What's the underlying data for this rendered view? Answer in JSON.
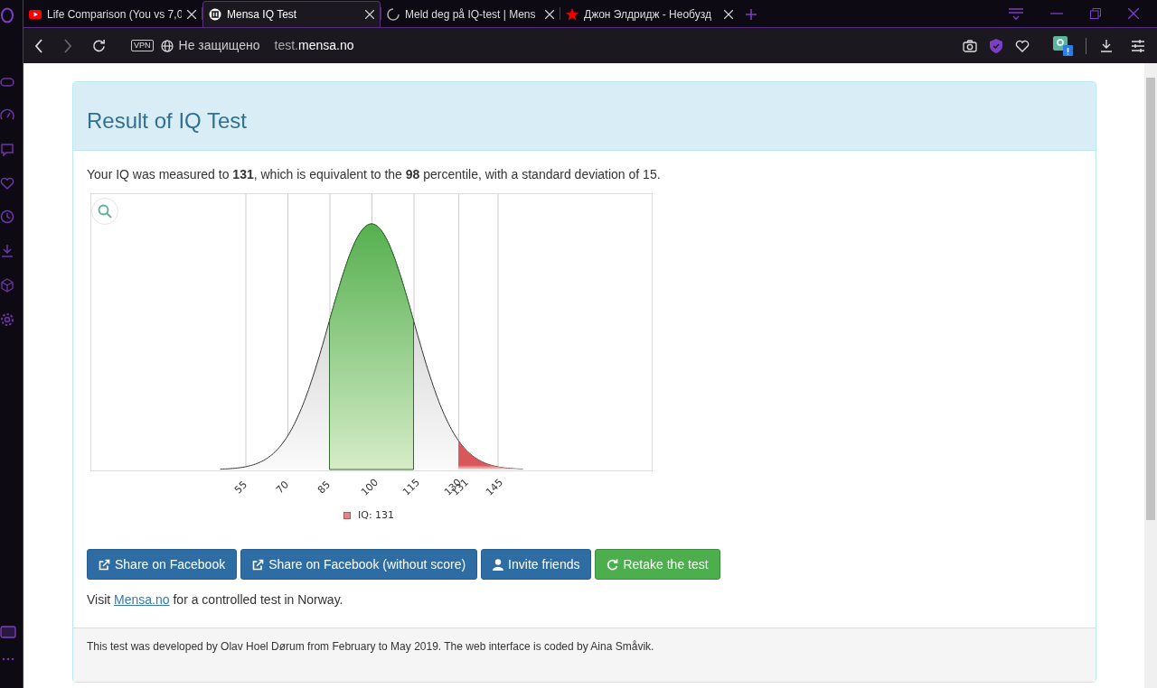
{
  "browser": {
    "tabs": [
      {
        "title": "Life Comparison (You vs 7,0",
        "kind": "video",
        "selected": false
      },
      {
        "title": "Mensa IQ Test",
        "kind": "mensa",
        "selected": true
      },
      {
        "title": "Meld deg på IQ-test | Mens",
        "kind": "loading",
        "selected": false
      },
      {
        "title": "Джон Элдридж - Необузд",
        "kind": "star",
        "selected": false
      }
    ],
    "address_bar": {
      "vpn_badge": "VPN",
      "security": "Не защищено",
      "url_subdomain": "test.",
      "url_domain": "mensa.no"
    }
  },
  "page": {
    "title": "Result of IQ Test",
    "summary": "Your IQ was measured to **131**, which is equivalent to the **98** percentile, with a standard deviation of 15.",
    "chart": {
      "tick_labels": [
        "55",
        "70",
        "85",
        "100",
        "115",
        "130",
        "145"
      ],
      "marker_label": "131",
      "legend": {
        "label": "IQ: 131",
        "color": "#d9898b"
      }
    },
    "buttons": [
      {
        "label": "Share on Facebook",
        "kind": "share"
      },
      {
        "label": "Share on Facebook (without score)",
        "kind": "share"
      },
      {
        "label": "Invite friends",
        "kind": "invite"
      },
      {
        "label": "Retake the test",
        "kind": "retake"
      }
    ],
    "visit": {
      "before": "Visit",
      "link": "Mensa.no",
      "after": "for a controlled test in Norway."
    },
    "footer": "This test was developed by Olav Hoel Dørum from February to May 2019. The web interface is coded by Aina Småvik."
  }
}
